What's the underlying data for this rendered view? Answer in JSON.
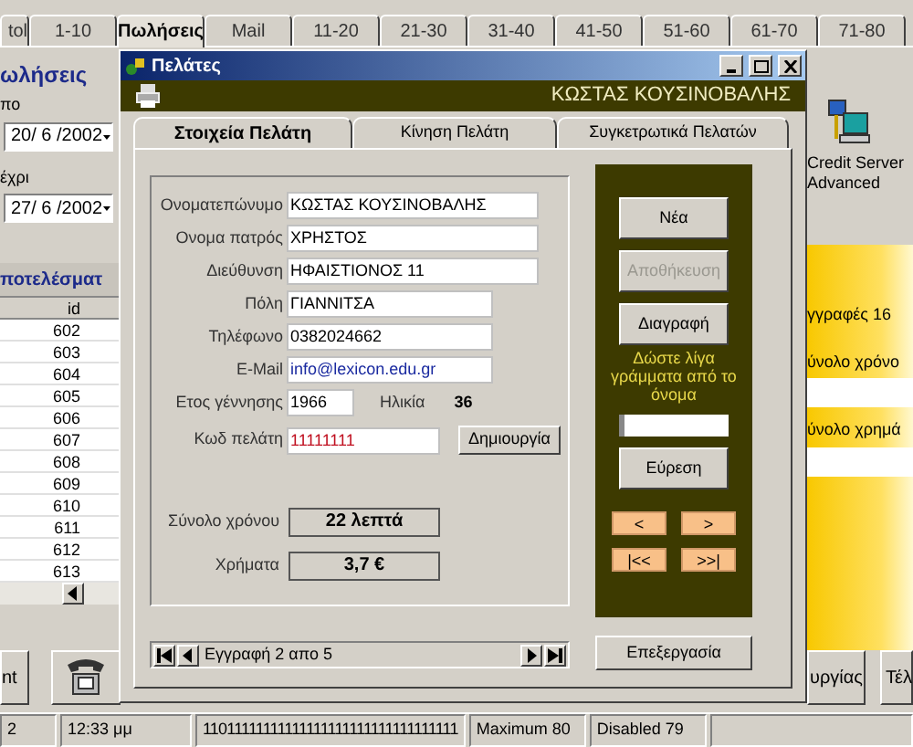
{
  "app_tabs": [
    {
      "label": "tol",
      "selected": false
    },
    {
      "label": "1-10",
      "selected": false
    },
    {
      "label": "Πωλήσεις",
      "selected": true
    },
    {
      "label": "Mail",
      "selected": false
    },
    {
      "label": "11-20",
      "selected": false
    },
    {
      "label": "21-30",
      "selected": false
    },
    {
      "label": "31-40",
      "selected": false
    },
    {
      "label": "41-50",
      "selected": false
    },
    {
      "label": "51-60",
      "selected": false
    },
    {
      "label": "61-70",
      "selected": false
    },
    {
      "label": "71-80",
      "selected": false
    }
  ],
  "left_panel": {
    "title": "ωλήσεις",
    "from_label": "πο",
    "from_date": "20/ 6 /2002",
    "to_label": "έχρι",
    "to_date": "27/ 6 /2002",
    "results_title": "ποτελέσματ",
    "table": {
      "columns": [
        "id"
      ],
      "rows": [
        [
          "602"
        ],
        [
          "603"
        ],
        [
          "604"
        ],
        [
          "605"
        ],
        [
          "606"
        ],
        [
          "607"
        ],
        [
          "608"
        ],
        [
          "609"
        ],
        [
          "610"
        ],
        [
          "611"
        ],
        [
          "612"
        ],
        [
          "613"
        ]
      ]
    }
  },
  "right_panel": {
    "server_label": "Credit Server Advanced",
    "records": "γγραφές 16",
    "total_time_label": "ύνολο χρόνο",
    "total_money_label": "ύνολο χρημά"
  },
  "bottom_buttons": [
    {
      "kind": "text",
      "label": "nt"
    },
    {
      "kind": "phone"
    },
    {
      "kind": "text",
      "label": "υργίας"
    },
    {
      "kind": "text",
      "label": "Τέλ"
    }
  ],
  "status_bar": [
    "2",
    "12:33 μμ",
    "11011111111111111111111111111111111",
    "Maximum 80",
    "Disabled 79"
  ],
  "dialog": {
    "title": "Πελάτες",
    "customer_header": "ΚΩΣΤΑΣ ΚΟΥΣΙΝΟΒΑΛΗΣ",
    "tabs": [
      {
        "label": "Στοιχεία Πελάτη",
        "selected": true
      },
      {
        "label": "Κίνηση Πελάτη",
        "selected": false
      },
      {
        "label": "Συγκετρωτικά Πελατών",
        "selected": false
      }
    ],
    "fields": [
      {
        "label": "Ονοματεπώνυμο",
        "value": "ΚΩΣΤΑΣ ΚΟΥΣΙΝΟΒΑΛΗΣ",
        "kind": "text"
      },
      {
        "label": "Ονομα πατρός",
        "value": "ΧΡΗΣΤΟΣ",
        "kind": "text"
      },
      {
        "label": "Διεύθυνση",
        "value": "ΗΦΑΙΣΤΙΟΝΟΣ 11",
        "kind": "text"
      },
      {
        "label": "Πόλη",
        "value": "ΓΙΑΝΝΙΤΣΑ",
        "kind": "text"
      },
      {
        "label": "Τηλέφωνο",
        "value": "0382024662",
        "kind": "text"
      },
      {
        "label": "E-Mail",
        "value": "info@lexicon.edu.gr",
        "kind": "email"
      }
    ],
    "birth_year": {
      "label": "Ετος γέννησης",
      "value": "1966",
      "age_label": "Ηλικία",
      "age": "36"
    },
    "customer_code": {
      "label": "Κωδ πελάτη",
      "value": "11111111",
      "button": "Δημιουργία"
    },
    "totals": [
      {
        "label": "Σύνολο χρόνου",
        "value": "22 λεπτά"
      },
      {
        "label": "Χρήματα",
        "value": "3,7 €"
      }
    ],
    "navigator": "Εγγραφή 2 απο 5",
    "actions": [
      {
        "label": "Νέα",
        "disabled": false
      },
      {
        "label": "Αποθήκευση",
        "disabled": true
      },
      {
        "label": "Διαγραφή",
        "disabled": false
      }
    ],
    "search_hint": "Δώστε λίγα γράμματα από το όνομα",
    "search_button": "Εύρεση",
    "nav_buttons": [
      "<",
      ">",
      "|<<",
      ">>|"
    ],
    "edit_button": "Επεξεργασία"
  }
}
